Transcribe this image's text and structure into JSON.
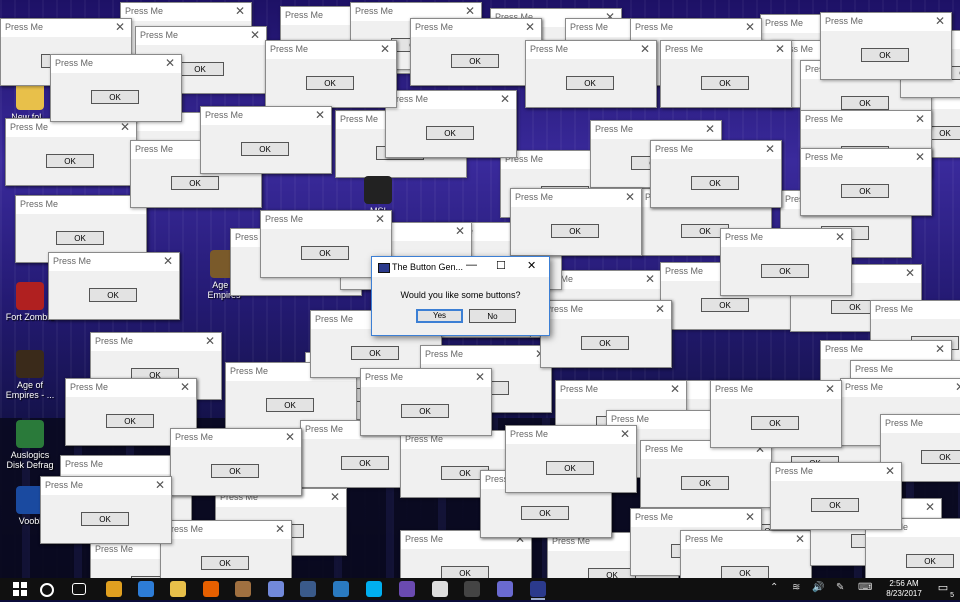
{
  "popup": {
    "title": "Press Me",
    "ok_label": "OK",
    "close_glyph": "✕"
  },
  "dialog": {
    "title": "The Button Gen...",
    "question": "Would you like some buttons?",
    "yes_label": "Yes",
    "no_label": "No",
    "minimize_glyph": "—",
    "maximize_glyph": "☐",
    "close_glyph": "✕",
    "accent_color": "#3c7fd4"
  },
  "desktop_icons": [
    {
      "label": "New fol...",
      "icon": "folder-icon",
      "color": "#e8c04a"
    },
    {
      "label": "Age o\nEmpires",
      "icon": "age-of-empires-icon",
      "color": "#7a5a2a"
    },
    {
      "label": "Fort Zombie",
      "icon": "fort-zombie-icon",
      "color": "#b02020"
    },
    {
      "label": "Age of\nEmpires - ...",
      "icon": "age-of-empires-icon",
      "color": "#3a2a1a"
    },
    {
      "label": "Auslogics\nDisk Defrag",
      "icon": "defrag-icon",
      "color": "#2a7a3a"
    },
    {
      "label": "Voobl",
      "icon": "voobly-icon",
      "color": "#1a4aa0"
    },
    {
      "label": "MSI",
      "icon": "msi-icon",
      "color": "#222222"
    }
  ],
  "taskbar": {
    "icons": [
      {
        "name": "windows-start-icon",
        "color": "#ffffff"
      },
      {
        "name": "cortana-icon",
        "color": "#ffffff"
      },
      {
        "name": "task-view-icon",
        "color": "#ffffff"
      },
      {
        "name": "chrome-icon",
        "color": "#e0a020"
      },
      {
        "name": "edge-icon",
        "color": "#2d7cd6"
      },
      {
        "name": "file-explorer-icon",
        "color": "#e8c04a"
      },
      {
        "name": "firefox-icon",
        "color": "#e66000"
      },
      {
        "name": "age-of-empires-taskbar-icon",
        "color": "#a07040"
      },
      {
        "name": "discord-icon",
        "color": "#7289da"
      },
      {
        "name": "steam-icon",
        "color": "#3a5a8a"
      },
      {
        "name": "window-app-icon",
        "color": "#2a7ac0"
      },
      {
        "name": "skype-icon",
        "color": "#00aff0"
      },
      {
        "name": "obs-icon",
        "color": "#6a4ab0"
      },
      {
        "name": "mail-icon",
        "color": "#dddddd"
      },
      {
        "name": "terminal-icon",
        "color": "#444444"
      },
      {
        "name": "media-app-icon",
        "color": "#6a6ad0"
      },
      {
        "name": "button-generator-taskbar-icon",
        "color": "#2b3a8c"
      }
    ],
    "tray_glyphs": {
      "chevron": "⌃",
      "network": "≋",
      "volume": "🔊",
      "pen": "✎",
      "keyboard": "⌨"
    },
    "time": "2:56 AM",
    "date": "8/23/2017",
    "notification_count": "5"
  }
}
